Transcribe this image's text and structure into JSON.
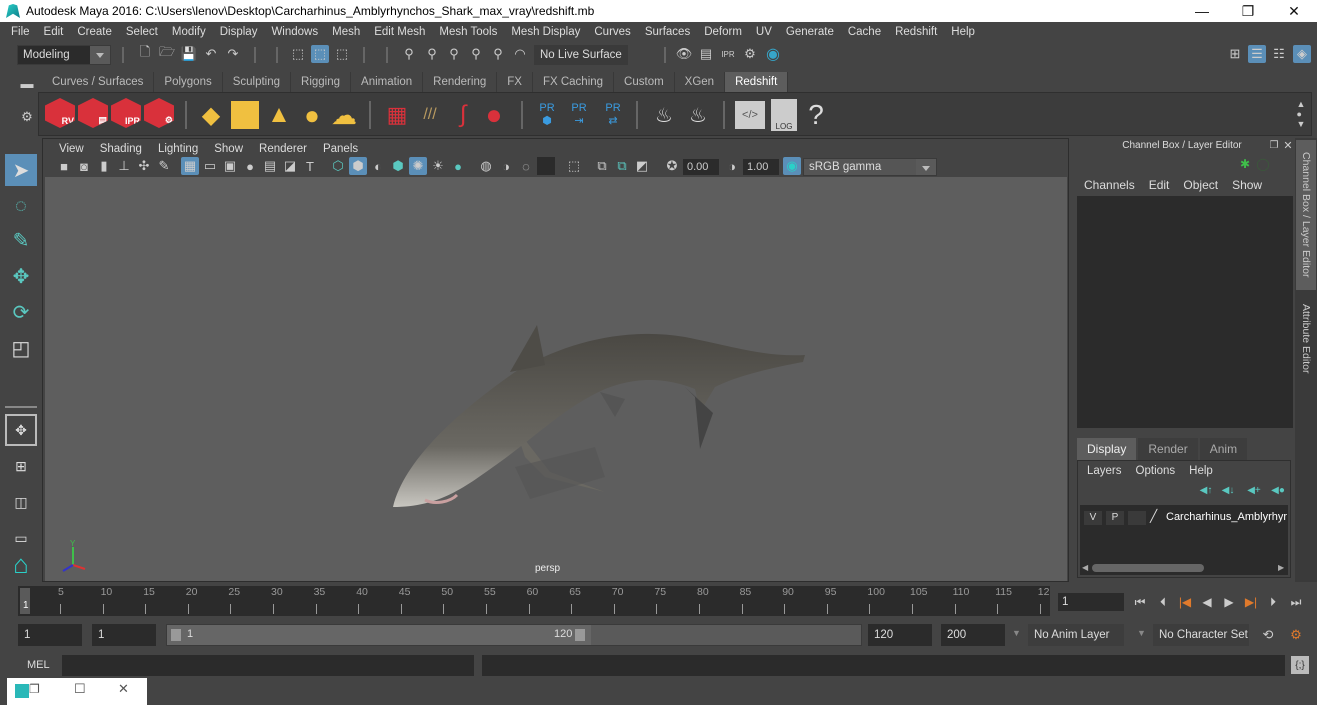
{
  "window": {
    "title": "Autodesk Maya 2016: C:\\Users\\lenov\\Desktop\\Carcharhinus_Amblyrhynchos_Shark_max_vray\\redshift.mb",
    "minimize": "—",
    "restore": "❐",
    "close": "✕"
  },
  "menubar": [
    "File",
    "Edit",
    "Create",
    "Select",
    "Modify",
    "Display",
    "Windows",
    "Mesh",
    "Edit Mesh",
    "Mesh Tools",
    "Mesh Display",
    "Curves",
    "Surfaces",
    "Deform",
    "UV",
    "Generate",
    "Cache",
    "Redshift",
    "Help"
  ],
  "statusline": {
    "mode": "Modeling",
    "live_surface": "No Live Surface"
  },
  "shelf": {
    "tabs": [
      "Curves / Surfaces",
      "Polygons",
      "Sculpting",
      "Rigging",
      "Animation",
      "Rendering",
      "FX",
      "FX Caching",
      "Custom",
      "XGen",
      "Redshift"
    ],
    "active_tab": "Redshift",
    "buttons": {
      "rv": "RV",
      "ipr": "IPR",
      "pr": "PR",
      "log": "LOG",
      "help": "?"
    }
  },
  "viewport": {
    "menu": [
      "View",
      "Shading",
      "Lighting",
      "Show",
      "Renderer",
      "Panels"
    ],
    "exposure": "0.00",
    "gamma": "1.00",
    "color_space": "sRGB gamma",
    "camera_label": "persp",
    "axis": {
      "y": "Y"
    }
  },
  "channel_box": {
    "title": "Channel Box / Layer Editor",
    "menu": [
      "Channels",
      "Edit",
      "Object",
      "Show"
    ]
  },
  "layer_editor": {
    "tabs": [
      "Display",
      "Render",
      "Anim"
    ],
    "active_tab": "Display",
    "menu": [
      "Layers",
      "Options",
      "Help"
    ],
    "layers": [
      {
        "v": "V",
        "p": "P",
        "name": "Carcharhinus_Amblyrhyr"
      }
    ]
  },
  "side_tabs": [
    "Channel Box / Layer Editor",
    "Attribute Editor"
  ],
  "timeline": {
    "labels": [
      "5",
      "10",
      "15",
      "20",
      "25",
      "30",
      "35",
      "40",
      "45",
      "50",
      "55",
      "60",
      "65",
      "70",
      "75",
      "80",
      "85",
      "90",
      "95",
      "100",
      "105",
      "110",
      "115",
      "12"
    ],
    "current_marker": "1",
    "current_frame": "1"
  },
  "range": {
    "start_time": "1",
    "playback_start": "1",
    "range_start_label": "1",
    "range_end_label": "120",
    "playback_end": "120",
    "end_time": "200",
    "anim_layer": "No Anim Layer",
    "character_set": "No Character Set"
  },
  "command_line": {
    "label": "MEL"
  },
  "colors": {
    "accent": "#5b8fb8",
    "redshift_red": "#d9313b",
    "viewport_bg": "#5e5e5e",
    "ui_bg": "#444444",
    "field_bg": "#2b2b2b",
    "key_orange": "#e07a2c"
  }
}
